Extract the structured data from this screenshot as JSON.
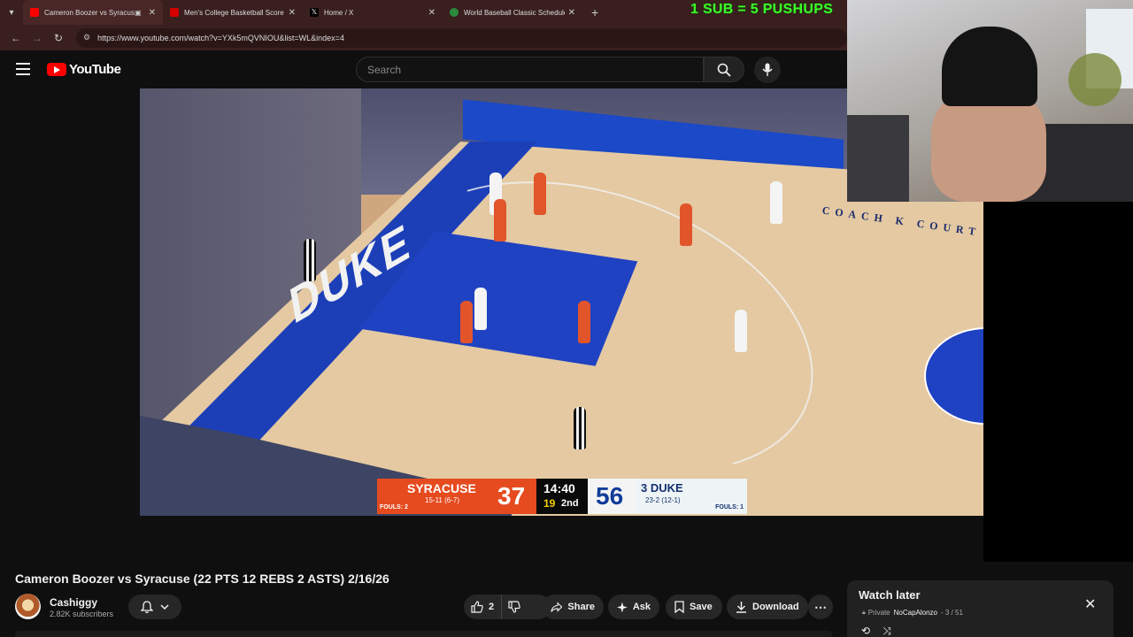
{
  "browser": {
    "tabs": [
      {
        "title": "Cameron Boozer vs Syracuse",
        "favicon_color": "#ff0000",
        "active": true
      },
      {
        "title": "Men's College Basketball Score",
        "favicon_color": "#d40000",
        "active": false
      },
      {
        "title": "Home / X",
        "favicon_color": "#000000",
        "active": false
      },
      {
        "title": "World Baseball Classic Schedule",
        "favicon_color": "#2b8a3e",
        "active": false
      }
    ],
    "url": "https://www.youtube.com/watch?v=YXk5mQVNIOU&list=WL&index=4"
  },
  "stream_overlay": {
    "banner": "1 SUB = 5 PUSHUPS",
    "color": "#3cff2a"
  },
  "youtube": {
    "logo_text": "YouTube",
    "search_placeholder": "Search"
  },
  "video": {
    "scoreboard": {
      "away": {
        "name": "SYRACUSE",
        "record": "15-11 (6-7)",
        "fouls": "FOULS: 2",
        "score": "37",
        "color": "#e54b1f"
      },
      "clock": {
        "time": "14:40",
        "shot_clock": "19",
        "period": "2nd"
      },
      "home": {
        "name": "3 DUKE",
        "record": "23-2 (12-1)",
        "fouls": "FOULS: 1",
        "score": "56",
        "color": "#123c9a"
      }
    },
    "court_text": "DUKE",
    "court_sign": "COACH K COURT"
  },
  "meta": {
    "title": "Cameron Boozer vs Syracuse (22 PTS 12 REBS 2 ASTS) 2/16/26",
    "channel": "Cashiggy",
    "subscribers": "2.82K subscribers",
    "likes": "2",
    "actions": {
      "share": "Share",
      "ask": "Ask",
      "save": "Save",
      "download": "Download"
    }
  },
  "playlist": {
    "title": "Watch later",
    "privacy": "Private",
    "owner": "NoCapAlonzo",
    "position": "- 3 / 51"
  }
}
